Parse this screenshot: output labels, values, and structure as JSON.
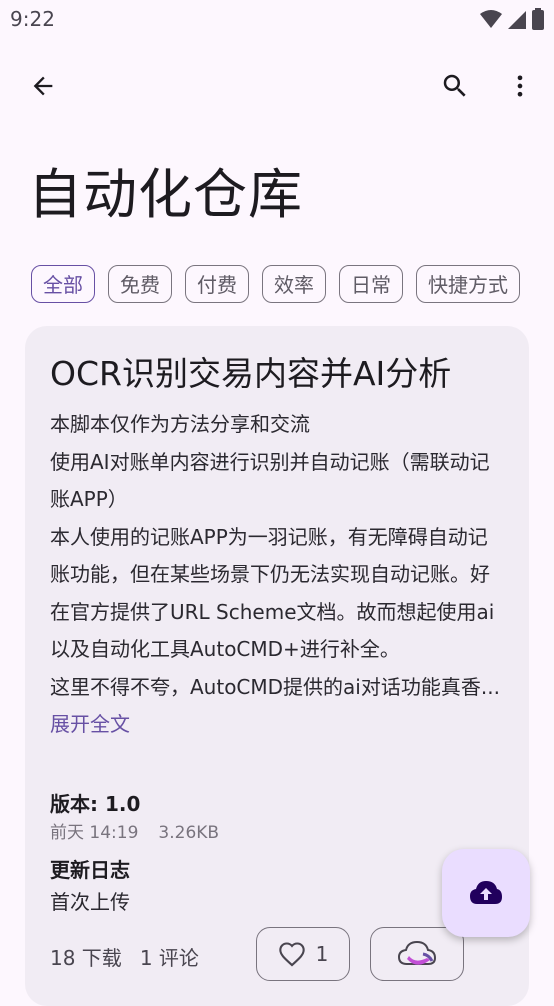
{
  "status_bar": {
    "time": "9:22"
  },
  "app_bar": {
    "back_icon": "arrow-back-icon",
    "search_icon": "search-icon",
    "more_icon": "more-vert-icon"
  },
  "page": {
    "title": "自动化仓库"
  },
  "filters": [
    {
      "label": "全部",
      "selected": true
    },
    {
      "label": "免费",
      "selected": false
    },
    {
      "label": "付费",
      "selected": false
    },
    {
      "label": "效率",
      "selected": false
    },
    {
      "label": "日常",
      "selected": false
    },
    {
      "label": "快捷方式",
      "selected": false
    }
  ],
  "script_card": {
    "title": "OCR识别交易内容并AI分析",
    "description": {
      "line1": "本脚本仅作为方法分享和交流",
      "line2": "使用AI对账单内容进行识别并自动记账（需联动记账APP）",
      "line3": "本人使用的记账APP为一羽记账，有无障碍自动记账功能，但在某些场景下仍无法实现自动记账。好在官方提供了URL Scheme文档。故而想起使用ai以及自动化工具AutoCMD+进行补全。",
      "line4": "这里不得不夸，AutoCMD提供的ai对话功能真香...",
      "expand_label": "展开全文"
    },
    "version": "版本: 1.0",
    "date": "前天 14:19",
    "size": "3.26KB",
    "changelog_title": "更新日志",
    "changelog_text": "首次上传",
    "downloads": "18 下载",
    "comments": "1 评论",
    "likes": "1"
  },
  "fab": {
    "icon": "cloud-upload-icon"
  },
  "colors": {
    "background": "#fdf7fe",
    "card": "#f1ecf4",
    "accent": "#6750a4",
    "fab": "#eaddff"
  }
}
